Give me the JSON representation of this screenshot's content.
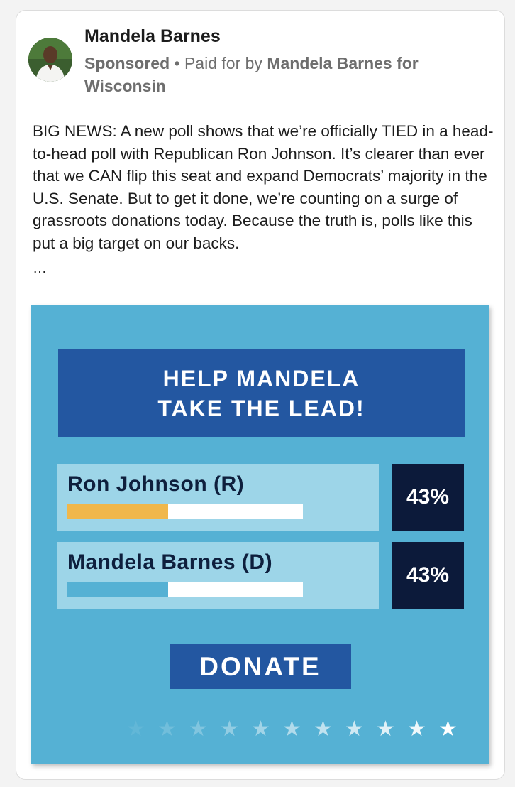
{
  "post": {
    "author": "Mandela Barnes",
    "sponsored_label": "Sponsored",
    "separator": " • ",
    "paid_for_prefix": "Paid for by ",
    "paid_for_name": "Mandela Barnes for Wisconsin",
    "body": "BIG NEWS: A new poll shows that we’re officially TIED in a head-to-head poll with Republican Ron Johnson. It’s clearer than ever that we CAN flip this seat and expand Democrats’ majority in the U.S. Senate. But to get it done, we’re counting on a surge of grassroots donations today. Because the truth is, polls like this put a big target on our backs.",
    "see_more": "…"
  },
  "ad": {
    "headline_line1": "HELP MANDELA",
    "headline_line2": "TAKE THE LEAD!",
    "candidates": [
      {
        "name": "Ron Johnson (R)",
        "percent_label": "43%",
        "bar_fraction": 0.43,
        "bar_color": "#f0b74b"
      },
      {
        "name": "Mandela Barnes (D)",
        "percent_label": "43%",
        "bar_fraction": 0.43,
        "bar_color": "#55b1d4"
      }
    ],
    "donate_label": "DONATE",
    "star_glyph": "★",
    "star_count": 11
  },
  "colors": {
    "ad_background": "#55b1d4",
    "headline_bg": "#2357a1",
    "percent_bg": "#0c1a3a"
  }
}
